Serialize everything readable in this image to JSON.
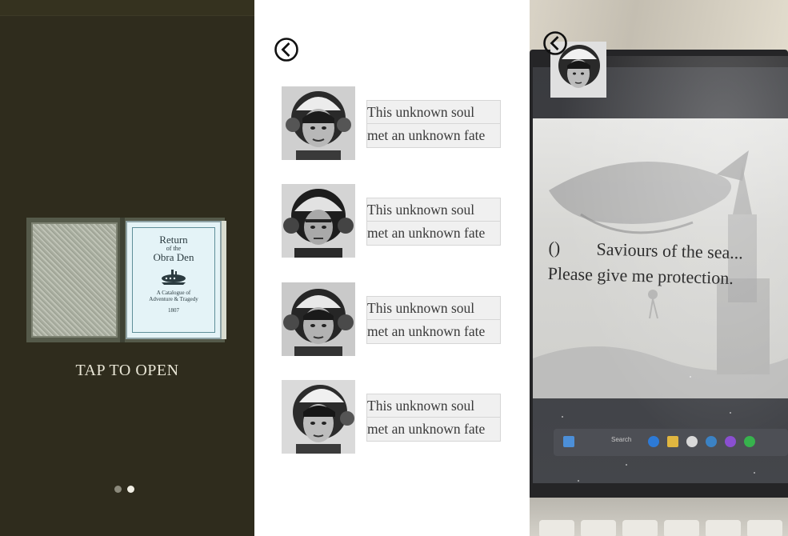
{
  "cover": {
    "book_title_line1": "Return",
    "book_title_line2": "of the",
    "book_title_line3": "Obra Den",
    "book_subtitle_line1": "A Catalogue of",
    "book_subtitle_line2": "Adventure & Tragedy",
    "book_year": "1807",
    "tap_label": "TAP TO OPEN",
    "page_indicator": {
      "total": 2,
      "active": 2
    }
  },
  "list": {
    "back_icon": "chevron-left-circle-icon",
    "items": [
      {
        "line1": "This unknown soul",
        "line2": "met an unknown fate"
      },
      {
        "line1": "This unknown soul",
        "line2": "met an unknown fate"
      },
      {
        "line1": "This unknown soul",
        "line2": "met an unknown fate"
      },
      {
        "line1": "This unknown soul",
        "line2": "met an unknown fate"
      }
    ]
  },
  "ar_view": {
    "back_icon": "chevron-left-circle-icon",
    "paren": "()",
    "line1": "Saviours of the sea...",
    "line2": "Please give me protection.",
    "taskbar_search": "Search"
  },
  "colors": {
    "cover_bg": "#2f2c1d",
    "book_front": "#e4f3f7",
    "caption_bg": "#f0f0f0",
    "caption_text": "#3a3a3a"
  }
}
